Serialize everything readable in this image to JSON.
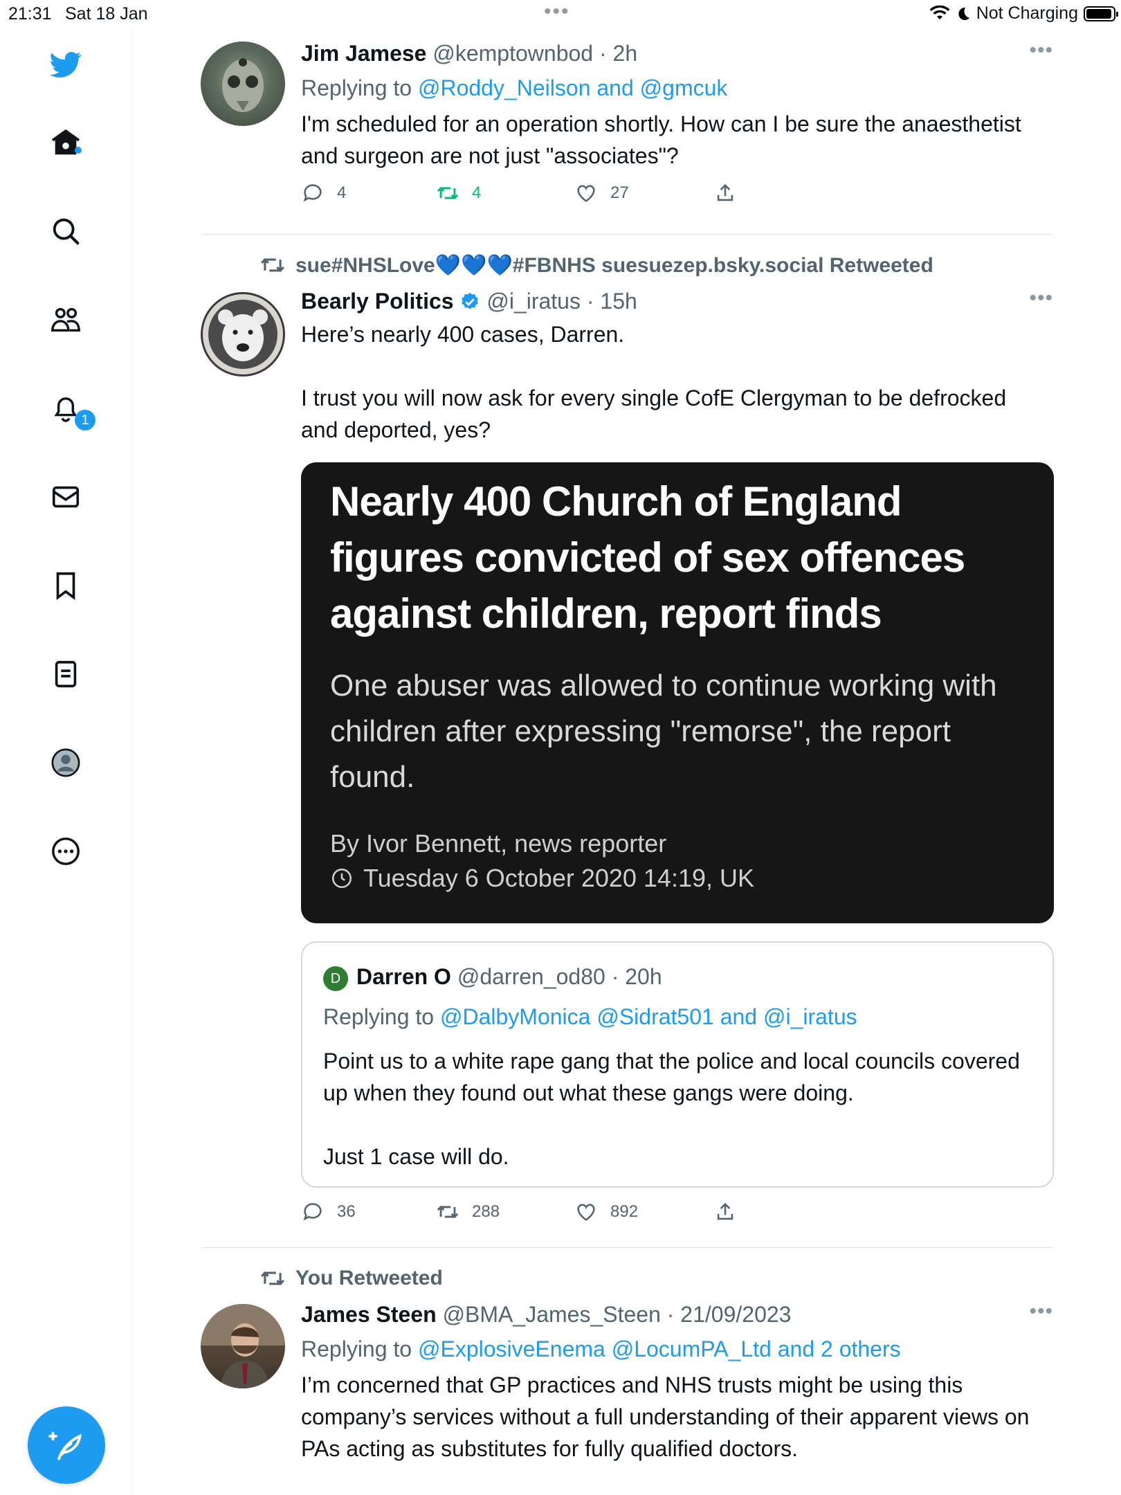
{
  "status_bar": {
    "time": "21:31",
    "date": "Sat 18 Jan",
    "battery_label": "Not Charging"
  },
  "sidebar": {
    "items": [
      "twitter-logo",
      "home",
      "search",
      "communities",
      "notifications",
      "messages",
      "bookmarks",
      "lists",
      "profile",
      "more"
    ],
    "notification_count": "1"
  },
  "tweets": [
    {
      "name": "Jim Jamese",
      "handle": "@kemptownbod",
      "time": "2h",
      "replying_prefix": "Replying to",
      "replying_to": "@Roddy_Neilson and @gmcuk",
      "text": "I'm scheduled for an operation shortly.  How can I be sure the anaesthetist and surgeon are not just \"associates\"?",
      "replies": "4",
      "retweets": "4",
      "likes": "27"
    },
    {
      "retweeted_by": "sue#NHSLove💙💙💙#FBNHS suesuezep.bsky.social Retweeted",
      "name": "Bearly Politics",
      "handle": "@i_iratus",
      "time": "15h",
      "text_p1": "Here’s nearly 400 cases, Darren.",
      "text_p2": "I trust you will now ask for every single CofE Clergyman to be defrocked and deported, yes?",
      "article": {
        "headline": "Nearly 400 Church of England figures convicted of sex offences against children, report finds",
        "subheadline": "One abuser was allowed to continue working with children after expressing \"remorse\", the report found.",
        "byline": "By Ivor Bennett, news reporter",
        "datetime": "Tuesday 6 October 2020 14:19, UK"
      },
      "quote": {
        "avatar_letter": "D",
        "name": "Darren O",
        "handle": "@darren_od80",
        "time": "20h",
        "replying_prefix": "Replying to",
        "replying_to": "@DalbyMonica @Sidrat501 and @i_iratus",
        "text_p1": "Point us to a white rape gang that the police and local councils covered up when they found out what these gangs were doing.",
        "text_p2": "Just 1 case will do."
      },
      "replies": "36",
      "retweets": "288",
      "likes": "892"
    },
    {
      "retweeted_by": "You Retweeted",
      "name": "James Steen",
      "handle": "@BMA_James_Steen",
      "time": "21/09/2023",
      "replying_prefix": "Replying to",
      "replying_to": "@ExplosiveEnema @LocumPA_Ltd and 2 others",
      "text": "I’m concerned that GP practices and NHS trusts might be using this company’s services without a full understanding of their apparent views on PAs acting as substitutes for fully qualified doctors."
    }
  ],
  "colors": {
    "accent": "#1d9bf0",
    "retweet_active": "#00ba7c",
    "muted": "#536471"
  }
}
